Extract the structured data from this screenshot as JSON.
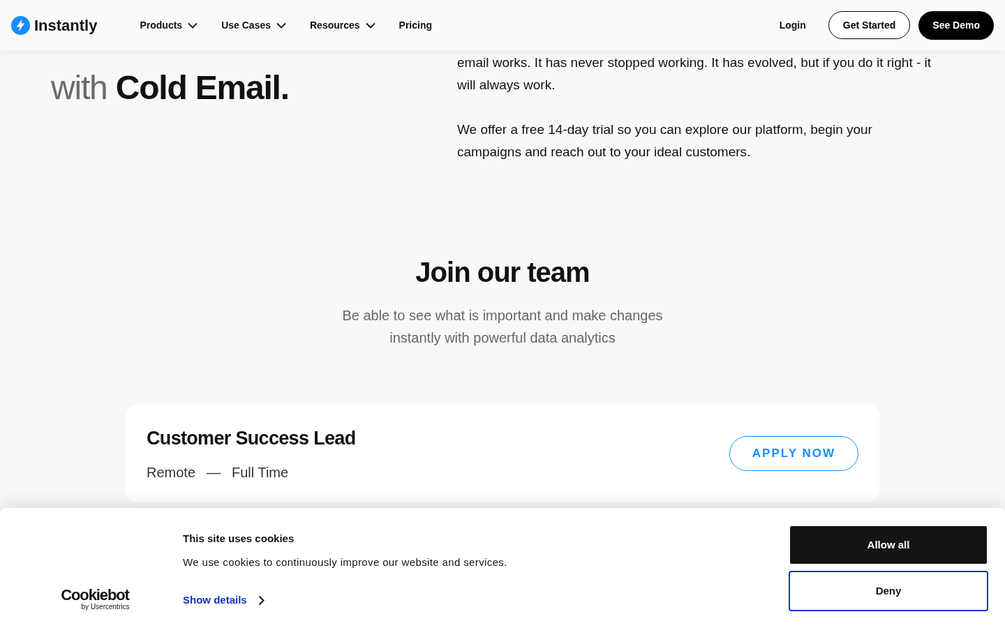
{
  "header": {
    "logo": "Instantly",
    "nav": [
      {
        "label": "Products",
        "dropdown": true
      },
      {
        "label": "Use Cases",
        "dropdown": true
      },
      {
        "label": "Resources",
        "dropdown": true
      },
      {
        "label": "Pricing",
        "dropdown": false
      }
    ],
    "login": "Login",
    "get_started": "Get Started",
    "see_demo": "See Demo"
  },
  "hero": {
    "headline_line_2": "with **Cold Email.**",
    "paragraphs": [
      "email works. It has never stopped working. It has evolved, but if you do it right - it will always work.",
      "We offer a free 14-day trial so you can explore our platform, begin your campaigns and reach out to your ideal customers."
    ]
  },
  "careers": {
    "title": "Join our team",
    "subtitle": "Be able to see what is important and make changes instantly with powerful data analytics",
    "jobs": [
      {
        "title": "Customer Success Lead",
        "location": "Remote",
        "separator": "—",
        "type": "Full Time",
        "button": "APPLY NOW"
      }
    ]
  },
  "cookie_banner": {
    "logo": "Cookiebot",
    "logo_sub": "by Usercentrics",
    "title": "This site uses cookies",
    "text": "We use cookies to continuously improve our website and services.",
    "details_link": "Show details",
    "allow_button": "Allow all",
    "deny_button": "Deny"
  }
}
